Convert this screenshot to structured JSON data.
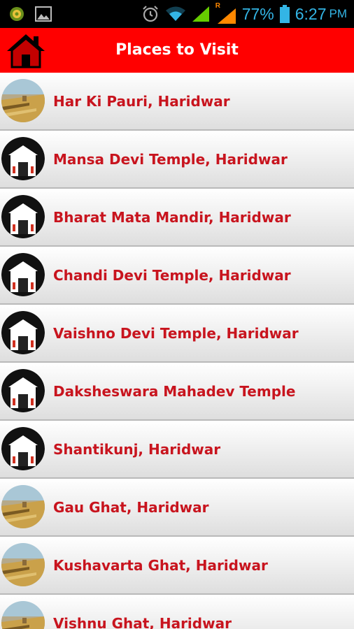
{
  "status": {
    "battery": "77%",
    "time": "6:27",
    "ampm": "PM",
    "roaming": "R"
  },
  "header": {
    "title": "Places to Visit"
  },
  "places": [
    {
      "label": "Har Ki Pauri, Haridwar",
      "thumb": "ghat"
    },
    {
      "label": "Mansa Devi Temple, Haridwar",
      "thumb": "temple"
    },
    {
      "label": "Bharat Mata Mandir, Haridwar",
      "thumb": "temple"
    },
    {
      "label": "Chandi Devi Temple, Haridwar",
      "thumb": "temple"
    },
    {
      "label": "Vaishno Devi Temple, Haridwar",
      "thumb": "temple"
    },
    {
      "label": "Daksheswara Mahadev Temple",
      "thumb": "temple"
    },
    {
      "label": "Shantikunj, Haridwar",
      "thumb": "temple"
    },
    {
      "label": "Gau Ghat, Haridwar",
      "thumb": "ghat"
    },
    {
      "label": "Kushavarta Ghat, Haridwar",
      "thumb": "ghat"
    },
    {
      "label": "Vishnu Ghat, Haridwar",
      "thumb": "ghat"
    }
  ],
  "colors": {
    "header": "#ff0000",
    "label": "#c8141e",
    "status_accent": "#33b5e5"
  }
}
